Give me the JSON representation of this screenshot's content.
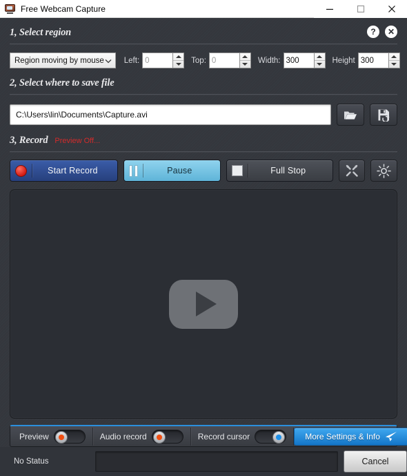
{
  "window": {
    "title": "Free Webcam Capture",
    "app_icon": "webcam-tv-icon",
    "minimize_label": "–",
    "maximize_label": "□",
    "close_label": "✕"
  },
  "header_icons": {
    "help_label": "?",
    "close_label": "✕"
  },
  "sections": {
    "region": {
      "title": "1, Select region",
      "mode_value": "Region moving by mouse",
      "fields": [
        {
          "label": "Left:",
          "value": "0",
          "dim": true
        },
        {
          "label": "Top:",
          "value": "0",
          "dim": true
        },
        {
          "label": "Width:",
          "value": "300",
          "dim": false
        },
        {
          "label": "Height",
          "value": "300",
          "dim": false
        }
      ]
    },
    "save": {
      "title": "2, Select where to save file",
      "path_value": "C:\\Users\\lin\\Documents\\Capture.avi",
      "browse_icon": "folder-open-icon",
      "saveas_icon": "save-disk-icon"
    },
    "record": {
      "title": "3, Record",
      "note": "Preview Off...",
      "buttons": {
        "start": "Start Record",
        "pause": "Pause",
        "stop": "Full Stop"
      },
      "tools_icon": "wrench-screwdriver-icon",
      "brightness_icon": "sun-brightness-icon"
    }
  },
  "video": {
    "play_icon": "play-button-icon"
  },
  "toggle_bar": {
    "items": [
      {
        "label": "Preview",
        "state": "off"
      },
      {
        "label": "Audio record",
        "state": "off"
      },
      {
        "label": "Record cursor",
        "state": "on"
      }
    ],
    "more_button": "More Settings & Info",
    "more_icon": "paper-plane-icon"
  },
  "statusbar": {
    "status": "No Status",
    "cancel_label": "Cancel",
    "progress_percent": 0
  },
  "colors": {
    "accent_blue": "#2a8fdd",
    "record_red": "#d41b12",
    "note_red": "#d32b2b",
    "pause_cyan": "#7fc9e6",
    "panel_bg": "#34373d"
  }
}
